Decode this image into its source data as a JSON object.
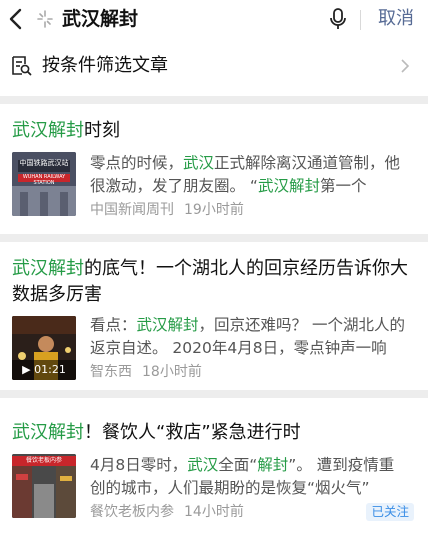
{
  "search": {
    "query": "武汉解封",
    "cancel_label": "取消"
  },
  "filter": {
    "label": "按条件筛选文章"
  },
  "results": [
    {
      "title_parts": [
        {
          "text": "武汉解封",
          "highlight": true
        },
        {
          "text": "时刻",
          "highlight": false
        }
      ],
      "snippet_parts": [
        {
          "text": "零点的时候，",
          "highlight": false
        },
        {
          "text": "武汉",
          "highlight": true
        },
        {
          "text": "正式解除离汉通道管制，他很激动，发了朋友圈。 “",
          "highlight": false
        },
        {
          "text": "武汉解封",
          "highlight": true
        },
        {
          "text": "第一个",
          "highlight": false
        }
      ],
      "source": "中国新闻周刊",
      "time": "19小时前",
      "thumb_text": "中国铁路武汉站",
      "thumb_subtext": "WUHAN RAILWAY STATION"
    },
    {
      "title_parts": [
        {
          "text": "武汉解封",
          "highlight": true
        },
        {
          "text": "的底气！一个湖北人的回京经历告诉你大数据多厉害",
          "highlight": false
        }
      ],
      "snippet_parts": [
        {
          "text": "看点：",
          "highlight": false
        },
        {
          "text": "武汉解封",
          "highlight": true
        },
        {
          "text": "，回京还难吗？ 一个湖北人的返京自述。 2020年4月8日，零点钟声一响",
          "highlight": false
        }
      ],
      "source": "智东西",
      "time": "18小时前",
      "video_duration": "▶ 01:21"
    },
    {
      "title_parts": [
        {
          "text": "武汉解封",
          "highlight": true
        },
        {
          "text": "！餐饮人“救店”紧急进行时",
          "highlight": false
        }
      ],
      "snippet_parts": [
        {
          "text": "4月8日零时，",
          "highlight": false
        },
        {
          "text": "武汉",
          "highlight": true
        },
        {
          "text": "全面“",
          "highlight": false
        },
        {
          "text": "解封",
          "highlight": true
        },
        {
          "text": "”。 遭到疫情重创的城市，人们最期盼的是恢复“烟火气”",
          "highlight": false
        }
      ],
      "source": "餐饮老板内参",
      "time": "14小时前",
      "follow_badge": "已关注",
      "thumb_text": "餐饮老板内参"
    }
  ],
  "colors": {
    "highlight": "#259b46",
    "link": "#576b95",
    "meta": "#9a9a9a",
    "divider": "#ededed"
  },
  "icons": [
    "back-arrow-icon",
    "sparkle-icon",
    "microphone-icon",
    "filter-search-icon",
    "chevron-right-icon",
    "play-icon"
  ]
}
